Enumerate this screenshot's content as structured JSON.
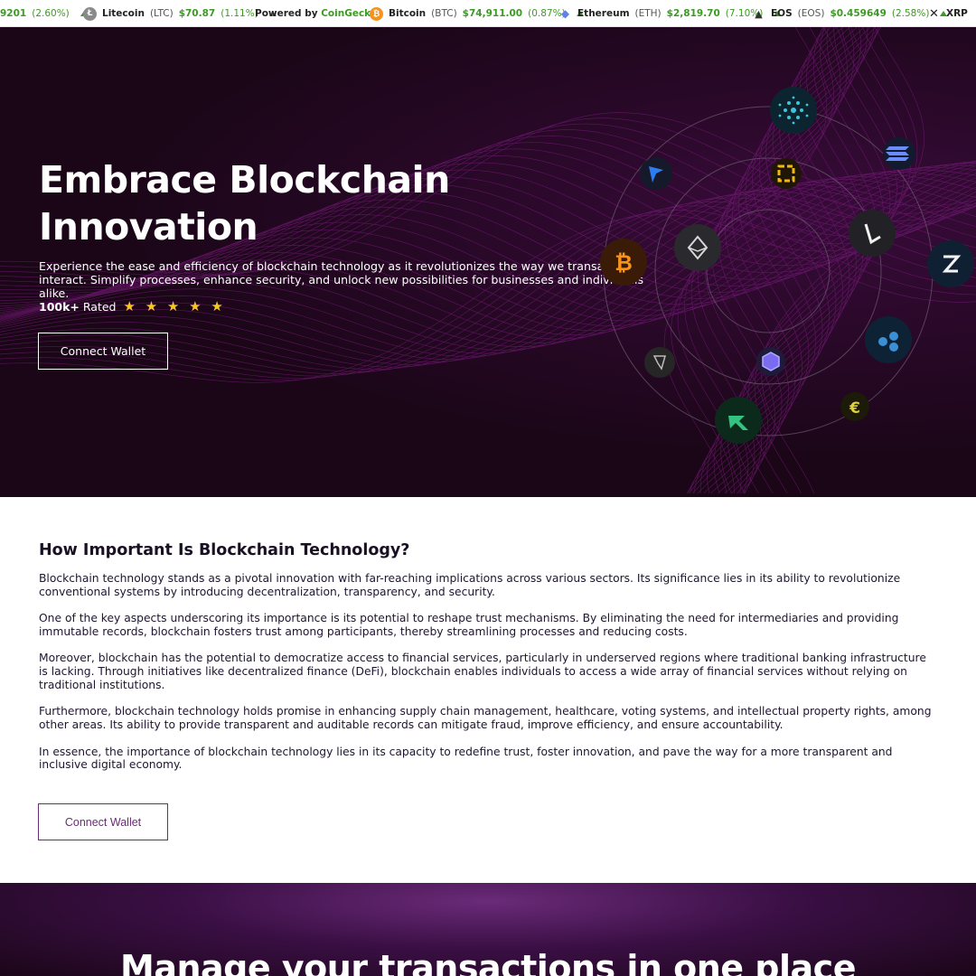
{
  "ticker": {
    "items": [
      {
        "name": "",
        "symbol": "",
        "price": "9201",
        "change": "(2.60%)",
        "icon": "",
        "color": ""
      },
      {
        "name": "Litecoin",
        "symbol": "(LTC)",
        "price": "$70.87",
        "change": "(1.11%)",
        "icon": "Ł",
        "color": "#8a8a8a"
      },
      {
        "name": "Bitcoin",
        "symbol": "(BTC)",
        "price": "$74,911.00",
        "change": "(0.87%)",
        "icon": "₿",
        "color": "#f7931a"
      },
      {
        "name": "Ethereum",
        "symbol": "(ETH)",
        "price": "$2,819.70",
        "change": "(7.10%)",
        "icon": "◆",
        "color": "#627eea"
      },
      {
        "name": "EOS",
        "symbol": "(EOS)",
        "price": "$0.459649",
        "change": "(2.58%)",
        "icon": "▲",
        "color": "#333333"
      },
      {
        "name": "XRP",
        "symbol": "",
        "price": "",
        "change": "",
        "icon": "✕",
        "color": "#222222"
      }
    ],
    "powered_label": "Powered by ",
    "powered_brand": "CoinGecko"
  },
  "hero": {
    "title_line1": "Embrace Blockchain",
    "title_line2": "Innovation",
    "description": "Experience the ease and efficiency of blockchain technology as it revolutionizes the way we transact and interact. Simplify processes, enhance security, and unlock new possibilities for businesses and individuals alike.",
    "rated_count": "100k+",
    "rated_label": "Rated",
    "stars": "★ ★ ★ ★ ★",
    "button_label": "Connect Wallet",
    "coin_icons": [
      "cardano-icon",
      "arrow-icon",
      "binance-icon",
      "solana-icon",
      "bitcoin-icon",
      "ethereum-icon",
      "litecoin-icon",
      "tron-icon",
      "ripple-icon",
      "polygon-icon",
      "eos-icon",
      "tether-icon",
      "euro-coin-icon"
    ]
  },
  "content": {
    "title": "How Important Is Blockchain Technology?",
    "paragraphs": [
      "Blockchain technology stands as a pivotal innovation with far-reaching implications across various sectors. Its significance lies in its ability to revolutionize conventional systems by introducing decentralization, transparency, and security.",
      "One of the key aspects underscoring its importance is its potential to reshape trust mechanisms. By eliminating the need for intermediaries and providing immutable records, blockchain fosters trust among participants, thereby streamlining processes and reducing costs.",
      "Moreover, blockchain has the potential to democratize access to financial services, particularly in underserved regions where traditional banking infrastructure is lacking. Through initiatives like decentralized finance (DeFi), blockchain enables individuals to access a wide array of financial services without relying on traditional institutions.",
      "Furthermore, blockchain technology holds promise in enhancing supply chain management, healthcare, voting systems, and intellectual property rights, among other areas. Its ability to provide transparent and auditable records can mitigate fraud, improve efficiency, and ensure accountability.",
      "In essence, the importance of blockchain technology lies in its capacity to redefine trust, foster innovation, and pave the way for a more transparent and inclusive digital economy."
    ],
    "button_label": "Connect Wallet"
  },
  "bottom": {
    "title": "Manage your transactions in one place"
  },
  "colors": {
    "hero_bg": "#1b0618",
    "accent_purple": "#6a2a78",
    "ticker_green": "#3b9b22",
    "star_yellow": "#f8c623"
  }
}
